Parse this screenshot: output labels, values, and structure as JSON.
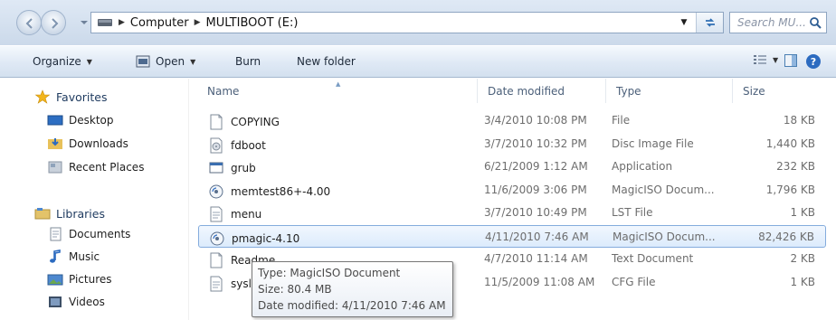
{
  "address": {
    "crumbs": [
      "Computer",
      "MULTIBOOT (E:)"
    ],
    "search_placeholder": "Search MU..."
  },
  "toolbar": {
    "organize_label": "Organize",
    "open_label": "Open",
    "burn_label": "Burn",
    "new_folder_label": "New folder"
  },
  "sidebar": {
    "favorites_label": "Favorites",
    "favorites": [
      "Desktop",
      "Downloads",
      "Recent Places"
    ],
    "libraries_label": "Libraries",
    "libraries": [
      "Documents",
      "Music",
      "Pictures",
      "Videos"
    ]
  },
  "columns": {
    "name": "Name",
    "date": "Date modified",
    "type": "Type",
    "size": "Size"
  },
  "files": [
    {
      "name": "COPYING",
      "date": "3/4/2010 10:08 PM",
      "type": "File",
      "size": "18 KB",
      "icon": "blank-file-icon"
    },
    {
      "name": "fdboot",
      "date": "3/7/2010 10:32 PM",
      "type": "Disc Image File",
      "size": "1,440 KB",
      "icon": "disc-image-icon"
    },
    {
      "name": "grub",
      "date": "6/21/2009 1:12 AM",
      "type": "Application",
      "size": "232 KB",
      "icon": "application-icon"
    },
    {
      "name": "memtest86+-4.00",
      "date": "11/6/2009 3:06 PM",
      "type": "MagicISO Docum...",
      "size": "1,796 KB",
      "icon": "magiciso-icon"
    },
    {
      "name": "menu",
      "date": "3/7/2010 10:49 PM",
      "type": "LST File",
      "size": "1 KB",
      "icon": "text-file-icon"
    },
    {
      "name": "pmagic-4.10",
      "date": "4/11/2010 7:46 AM",
      "type": "MagicISO Docum...",
      "size": "82,426 KB",
      "icon": "magiciso-icon",
      "selected": true
    },
    {
      "name": "Readme",
      "date": "4/7/2010 11:14 AM",
      "type": "Text Document",
      "size": "2 KB",
      "icon": "blank-file-icon"
    },
    {
      "name": "sysli",
      "date": "11/5/2009 11:08 AM",
      "type": "CFG File",
      "size": "1 KB",
      "icon": "text-file-icon"
    }
  ],
  "tooltip": {
    "type_line": "Type: MagicISO Document",
    "size_line": "Size: 80.4 MB",
    "date_line": "Date modified: 4/11/2010 7:46 AM"
  },
  "colors": {
    "chrome_top": "#dfe9f5",
    "selection_border": "#84acdd",
    "header_text": "#4c607a"
  }
}
